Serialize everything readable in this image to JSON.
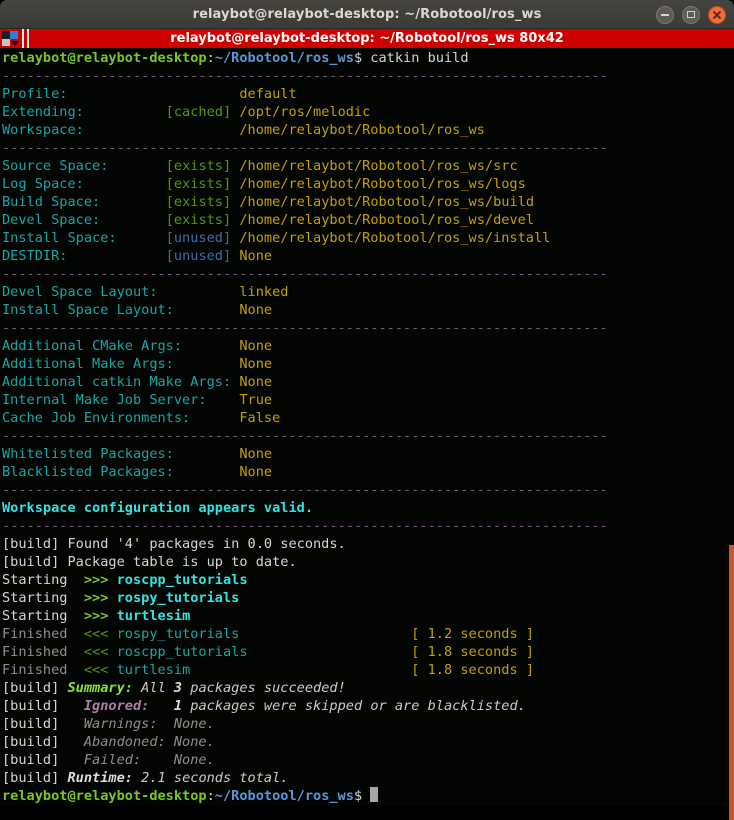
{
  "window": {
    "title": "relaybot@relaybot-desktop: ~/Robotool/ros_ws"
  },
  "tab_bar": {
    "title": "relaybot@relaybot-desktop: ~/Robotool/ros_ws 80x42"
  },
  "colors": {
    "titlebar_bg": "#3e3d39",
    "caption_bar_red": "#cf0000",
    "close_button_orange": "#ee6d3f",
    "scrollbar_orange": "#c05b28",
    "terminal_bg": "#030503",
    "foreground": "#d3d7cf",
    "dim": "#8e9089",
    "green": "#4e9a06",
    "bright_green": "#7ac52a",
    "cyan": "#17a6a6",
    "bright_cyan": "#34e2e2",
    "yellow": "#c4a000",
    "blue": "#3a6fb0",
    "bright_blue": "#5c96d6",
    "purple": "#7b5a84",
    "bright_purple": "#ad7fa8"
  },
  "terminal": {
    "lines": [
      [
        [
          "gb",
          "relaybot@relaybot-desktop"
        ],
        [
          "w",
          ":"
        ],
        [
          "bb",
          "~/Robotool/ros_ws"
        ],
        [
          "w",
          "$ catkin build"
        ]
      ],
      [
        [
          "p",
          "--------------------------------------------------------------------------"
        ]
      ],
      [
        [
          "c",
          "Profile:"
        ],
        [
          "w",
          "                     "
        ],
        [
          "y",
          "default"
        ]
      ],
      [
        [
          "c",
          "Extending:"
        ],
        [
          "w",
          "          "
        ],
        [
          "g",
          "[cached]"
        ],
        [
          "w",
          " "
        ],
        [
          "y",
          "/opt/ros/melodic"
        ]
      ],
      [
        [
          "c",
          "Workspace:"
        ],
        [
          "w",
          "                   "
        ],
        [
          "y",
          "/home/relaybot/Robotool/ros_ws"
        ]
      ],
      [
        [
          "p",
          "--------------------------------------------------------------------------"
        ]
      ],
      [
        [
          "c",
          "Source Space:"
        ],
        [
          "w",
          "       "
        ],
        [
          "g",
          "[exists]"
        ],
        [
          "w",
          " "
        ],
        [
          "y",
          "/home/relaybot/Robotool/ros_ws/src"
        ]
      ],
      [
        [
          "c",
          "Log Space:"
        ],
        [
          "w",
          "          "
        ],
        [
          "g",
          "[exists]"
        ],
        [
          "w",
          " "
        ],
        [
          "y",
          "/home/relaybot/Robotool/ros_ws/logs"
        ]
      ],
      [
        [
          "c",
          "Build Space:"
        ],
        [
          "w",
          "        "
        ],
        [
          "g",
          "[exists]"
        ],
        [
          "w",
          " "
        ],
        [
          "y",
          "/home/relaybot/Robotool/ros_ws/build"
        ]
      ],
      [
        [
          "c",
          "Devel Space:"
        ],
        [
          "w",
          "        "
        ],
        [
          "g",
          "[exists]"
        ],
        [
          "w",
          " "
        ],
        [
          "y",
          "/home/relaybot/Robotool/ros_ws/devel"
        ]
      ],
      [
        [
          "c",
          "Install Space:"
        ],
        [
          "w",
          "      "
        ],
        [
          "b",
          "[unused]"
        ],
        [
          "w",
          " "
        ],
        [
          "y",
          "/home/relaybot/Robotool/ros_ws/install"
        ]
      ],
      [
        [
          "c",
          "DESTDIR:"
        ],
        [
          "w",
          "            "
        ],
        [
          "b",
          "[unused]"
        ],
        [
          "w",
          " "
        ],
        [
          "y",
          "None"
        ]
      ],
      [
        [
          "p",
          "--------------------------------------------------------------------------"
        ]
      ],
      [
        [
          "c",
          "Devel Space Layout:"
        ],
        [
          "w",
          "          "
        ],
        [
          "y",
          "linked"
        ]
      ],
      [
        [
          "c",
          "Install Space Layout:"
        ],
        [
          "w",
          "        "
        ],
        [
          "y",
          "None"
        ]
      ],
      [
        [
          "p",
          "--------------------------------------------------------------------------"
        ]
      ],
      [
        [
          "c",
          "Additional CMake Args:"
        ],
        [
          "w",
          "       "
        ],
        [
          "y",
          "None"
        ]
      ],
      [
        [
          "c",
          "Additional Make Args:"
        ],
        [
          "w",
          "        "
        ],
        [
          "y",
          "None"
        ]
      ],
      [
        [
          "c",
          "Additional catkin Make Args:"
        ],
        [
          "w",
          " "
        ],
        [
          "y",
          "None"
        ]
      ],
      [
        [
          "c",
          "Internal Make Job Server:"
        ],
        [
          "w",
          "    "
        ],
        [
          "y",
          "True"
        ]
      ],
      [
        [
          "c",
          "Cache Job Environments:"
        ],
        [
          "w",
          "      "
        ],
        [
          "y",
          "False"
        ]
      ],
      [
        [
          "p",
          "--------------------------------------------------------------------------"
        ]
      ],
      [
        [
          "c",
          "Whitelisted Packages:"
        ],
        [
          "w",
          "        "
        ],
        [
          "y",
          "None"
        ]
      ],
      [
        [
          "c",
          "Blacklisted Packages:"
        ],
        [
          "w",
          "        "
        ],
        [
          "y",
          "None"
        ]
      ],
      [
        [
          "p",
          "--------------------------------------------------------------------------"
        ]
      ],
      [
        [
          "cb",
          "Workspace configuration appears valid."
        ]
      ],
      [
        [
          "p",
          "--------------------------------------------------------------------------"
        ]
      ],
      [
        [
          "w",
          "[build] Found '4' packages in 0.0 seconds."
        ]
      ],
      [
        [
          "w",
          "[build] Package table is up to date."
        ]
      ],
      [
        [
          "w",
          "Starting  "
        ],
        [
          "gb",
          ">>>"
        ],
        [
          "w",
          " "
        ],
        [
          "cb",
          "roscpp_tutorials"
        ]
      ],
      [
        [
          "w",
          "Starting  "
        ],
        [
          "gb",
          ">>>"
        ],
        [
          "w",
          " "
        ],
        [
          "cb",
          "rospy_tutorials"
        ]
      ],
      [
        [
          "w",
          "Starting  "
        ],
        [
          "gb",
          ">>>"
        ],
        [
          "w",
          " "
        ],
        [
          "cb",
          "turtlesim"
        ]
      ],
      [
        [
          "d",
          "Finished  "
        ],
        [
          "g",
          "<<<"
        ],
        [
          "w",
          " "
        ],
        [
          "c",
          "rospy_tutorials"
        ],
        [
          "w",
          "                     "
        ],
        [
          "y",
          "[ 1.2 seconds ]"
        ]
      ],
      [
        [
          "d",
          "Finished  "
        ],
        [
          "g",
          "<<<"
        ],
        [
          "w",
          " "
        ],
        [
          "c",
          "roscpp_tutorials"
        ],
        [
          "w",
          "                    "
        ],
        [
          "y",
          "[ 1.8 seconds ]"
        ]
      ],
      [
        [
          "d",
          "Finished  "
        ],
        [
          "g",
          "<<<"
        ],
        [
          "w",
          " "
        ],
        [
          "c",
          "turtlesim"
        ],
        [
          "w",
          "                           "
        ],
        [
          "y",
          "[ 1.8 seconds ]"
        ]
      ],
      [
        [
          "w",
          "[build] "
        ],
        [
          "gbi",
          "Summary:"
        ],
        [
          "wi",
          " All "
        ],
        [
          "wbi",
          "3"
        ],
        [
          "wi",
          " packages succeeded!"
        ]
      ],
      [
        [
          "w",
          "[build]   "
        ],
        [
          "pbi",
          "Ignored:"
        ],
        [
          "wi",
          "   "
        ],
        [
          "wbi",
          "1"
        ],
        [
          "wi",
          " packages were skipped or are blacklisted."
        ]
      ],
      [
        [
          "w",
          "[build]   "
        ],
        [
          "di",
          "Warnings:  None."
        ]
      ],
      [
        [
          "w",
          "[build]   "
        ],
        [
          "di",
          "Abandoned: None."
        ]
      ],
      [
        [
          "w",
          "[build]   "
        ],
        [
          "di",
          "Failed:    None."
        ]
      ],
      [
        [
          "w",
          "[build] "
        ],
        [
          "wbi",
          "Runtime:"
        ],
        [
          "wi",
          " 2.1 seconds total."
        ]
      ],
      [
        [
          "gb",
          "relaybot@relaybot-desktop"
        ],
        [
          "w",
          ":"
        ],
        [
          "bb",
          "~/Robotool/ros_ws"
        ],
        [
          "w",
          "$ "
        ],
        [
          "cur",
          ""
        ]
      ]
    ]
  }
}
